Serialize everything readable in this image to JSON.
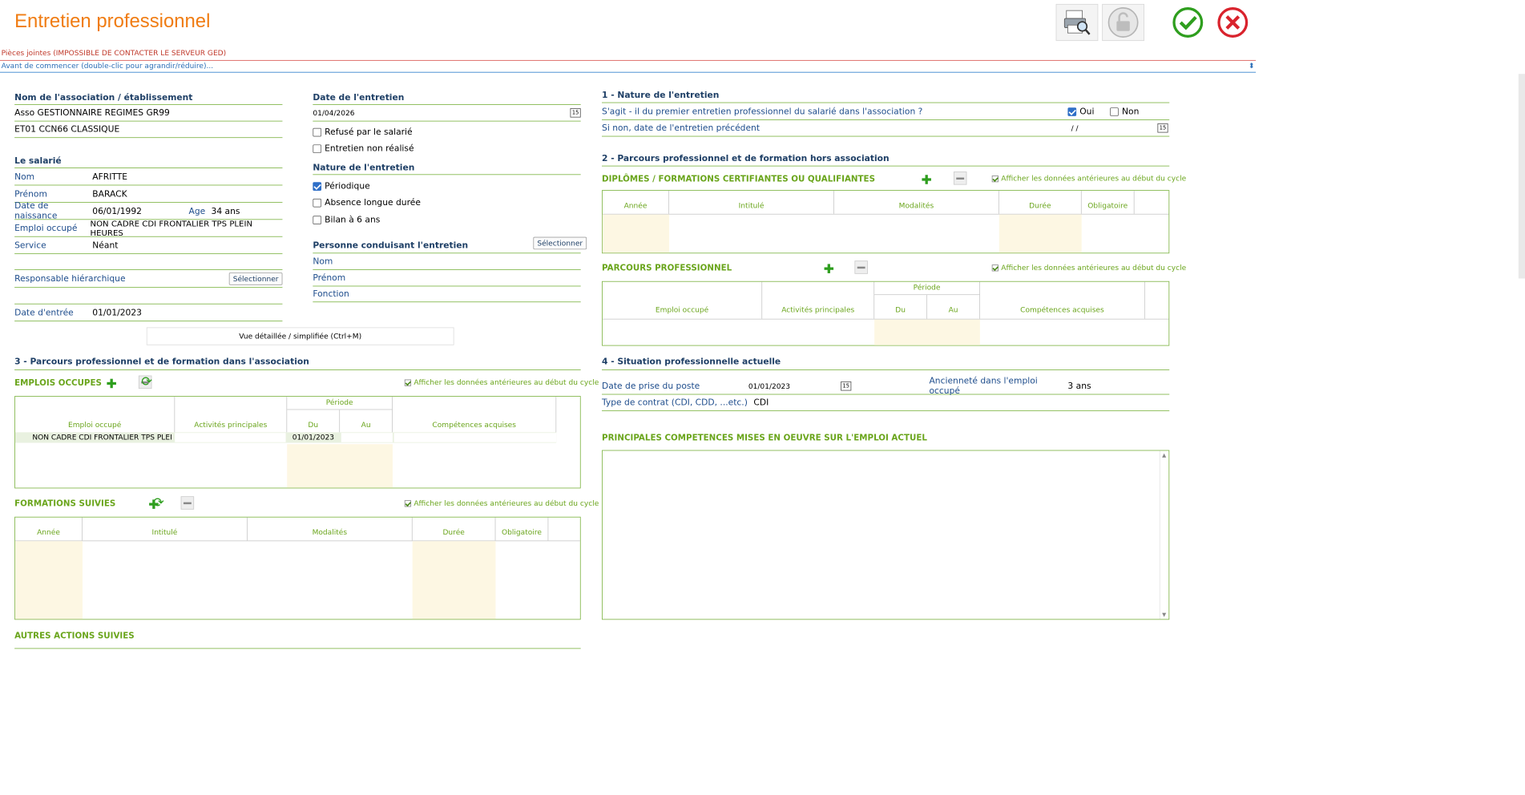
{
  "app": {
    "title": "Entretien professionnel",
    "attachments": "Pièces jointes (IMPOSSIBLE DE CONTACTER LE SERVEUR GED)",
    "before": "Avant de commencer (double-clic pour agrandir/réduire)..."
  },
  "colors": {
    "title": "#f07c12",
    "accent_green": "#6aa51c",
    "label_blue": "#1e4d8c",
    "error_red": "#c0392b"
  },
  "icons": [
    "print-preview-icon",
    "unlock-icon",
    "validate-icon",
    "cancel-icon"
  ],
  "left": {
    "org_header": "Nom de l'association / établissement",
    "org_name": "Asso GESTIONNAIRE REGIMES GR99",
    "org_etab": "ET01 CCN66 CLASSIQUE",
    "employee_header": "Le salarié",
    "nom_label": "Nom",
    "nom": "AFRITTE",
    "prenom_label": "Prénom",
    "prenom": "BARACK",
    "dob_label": "Date de naissance",
    "dob": "06/01/1992",
    "age_label": "Age",
    "age": "34 ans",
    "job_label": "Emploi occupé",
    "job": "NON CADRE CDI FRONTALIER TPS PLEIN HEURES",
    "service_label": "Service",
    "service": "Néant",
    "manager_label": "Responsable hiérarchique",
    "select": "Sélectionner",
    "entry_label": "Date d'entrée",
    "entry": "01/01/2023",
    "toggle": "Vue détaillée / simplifiée (Ctrl+M)"
  },
  "mid": {
    "date_header": "Date de l'entretien",
    "date": "01/04/2026",
    "refused": "Refusé par le salarié",
    "not_done": "Entretien non réalisé",
    "nature_header": "Nature de l'entretien",
    "periodic": "Périodique",
    "absence": "Absence longue durée",
    "bilan": "Bilan à 6 ans",
    "person_header": "Personne conduisant l'entretien",
    "select": "Sélectionner",
    "nom": "Nom",
    "prenom": "Prénom",
    "fonction": "Fonction"
  },
  "sec3": {
    "title": "3 - Parcours professionnel et de formation dans l'association",
    "show_prev": "Afficher les données antérieures au début du cycle",
    "emplois": {
      "title": "EMPLOIS OCCUPES",
      "cols": [
        "Emploi occupé",
        "Activités principales",
        "Période",
        "Du",
        "Au",
        "Compétences acquises"
      ],
      "row": [
        "NON CADRE CDI FRONTALIER TPS PLEIN...",
        "",
        "01/01/2023",
        "",
        ""
      ]
    },
    "formations": {
      "title": "FORMATIONS SUIVIES",
      "cols": [
        "Année",
        "Intitulé",
        "Modalités",
        "Durée",
        "Obligatoire"
      ]
    },
    "autres": "AUTRES ACTIONS SUIVIES"
  },
  "right": {
    "s1_title": "1 - Nature de l'entretien",
    "q_first": "S'agit - il du premier entretien professionnel du salarié dans l'association ?",
    "oui": "Oui",
    "non": "Non",
    "q_prev": "Si non, date de l'entretien précédent",
    "prev_date": "/ /",
    "s2_title": "2 - Parcours professionnel et de formation hors association",
    "dipl_title": "DIPLÔMES / FORMATIONS CERTIFIANTES OU QUALIFIANTES",
    "dipl_cols": [
      "Année",
      "Intitulé",
      "Modalités",
      "Durée",
      "Obligatoire"
    ],
    "parcours_title": "PARCOURS PROFESSIONNEL",
    "parcours_cols": [
      "Emploi occupé",
      "Activités principales",
      "Période",
      "Du",
      "Au",
      "Compétences acquises"
    ],
    "show_prev": "Afficher les données antérieures au début du cycle",
    "s4_title": "4 - Situation professionnelle actuelle",
    "prise_label": "Date de prise du poste",
    "prise": "01/01/2023",
    "anc_label": "Ancienneté dans l'emploi occupé",
    "anc": "3 ans",
    "contrat_label": "Type de contrat (CDI, CDD, ...etc.)",
    "contrat": "CDI",
    "competences_title": "PRINCIPALES COMPETENCES MISES EN OEUVRE SUR L'EMPLOI ACTUEL"
  }
}
